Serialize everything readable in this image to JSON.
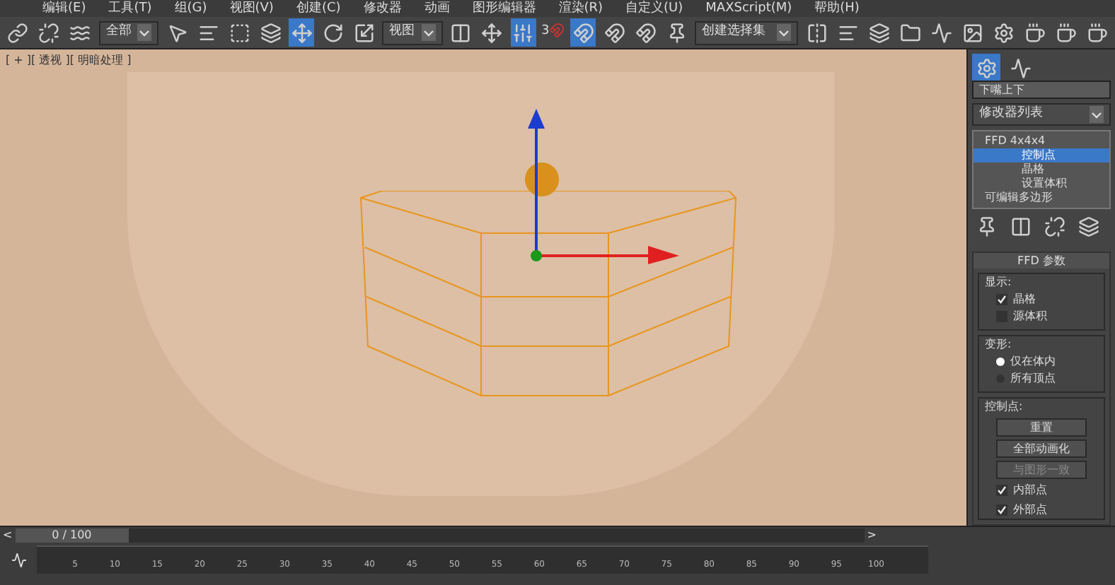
{
  "menu": [
    "编辑(E)",
    "工具(T)",
    "组(G)",
    "视图(V)",
    "创建(C)",
    "修改器",
    "动画",
    "图形编辑器",
    "渲染(R)",
    "自定义(U)",
    "MAXScript(M)",
    "帮助(H)"
  ],
  "toolbar": {
    "selection_filter": "全部",
    "reference_coord": "视图",
    "named_selection": "创建选择集",
    "snap_label": "3"
  },
  "viewport": {
    "label": "[ + ][ 透视 ][ 明暗处理 ]"
  },
  "command_panel": {
    "object_name": "下嘴上下",
    "modifier_list": "修改器列表",
    "stack": [
      {
        "label": "FFD 4x4x4",
        "selected": false,
        "children": [
          {
            "label": "控制点",
            "selected": true
          },
          {
            "label": "晶格",
            "selected": false
          },
          {
            "label": "设置体积",
            "selected": false
          }
        ]
      },
      {
        "label": "可编辑多边形",
        "selected": false
      }
    ],
    "rollout_title": "FFD 参数",
    "display": {
      "title": "显示:",
      "options": [
        {
          "label": "晶格",
          "checked": true
        },
        {
          "label": "源体积",
          "checked": false
        }
      ]
    },
    "deform": {
      "title": "变形:",
      "options": [
        {
          "label": "仅在体内",
          "selected": true
        },
        {
          "label": "所有顶点",
          "selected": false
        }
      ]
    },
    "control_points": {
      "title": "控制点:",
      "buttons": [
        {
          "label": "重置",
          "disabled": false
        },
        {
          "label": "全部动画化",
          "disabled": false
        },
        {
          "label": "与图形一致",
          "disabled": true
        }
      ],
      "options": [
        {
          "label": "内部点",
          "checked": true
        },
        {
          "label": "外部点",
          "checked": true
        }
      ]
    }
  },
  "timeline": {
    "frame": "0 / 100",
    "level": 0,
    "prev": "<",
    "next": ">",
    "ticks": [
      "5",
      "10",
      "15",
      "20",
      "25",
      "30",
      "35",
      "40",
      "45",
      "50",
      "55",
      "60",
      "65",
      "70",
      "75",
      "80",
      "85",
      "90",
      "95",
      "100"
    ]
  }
}
